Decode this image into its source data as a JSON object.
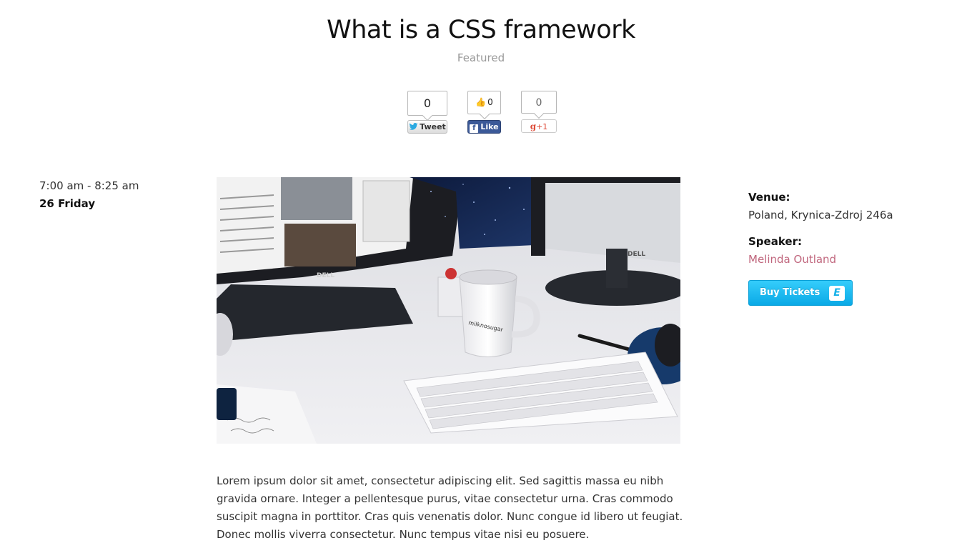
{
  "event": {
    "title": "What is a CSS framework",
    "category": "Featured",
    "time": "7:00 am - 8:25 am",
    "date": "26 Friday",
    "description": "Lorem ipsum dolor sit amet, consectetur adipiscing elit. Sed sagittis massa eu nibh gravida ornare. Integer a pellentesque purus, vitae consectetur urna. Cras commodo suscipit magna in porttitor. Cras quis venenatis dolor. Nunc congue id libero ut feugiat. Donec mollis viverra consectetur. Nunc tempus vitae nisi eu posuere."
  },
  "share": {
    "twitter": {
      "count": "0",
      "label": "Tweet",
      "icon": "twitter-bird-icon"
    },
    "facebook": {
      "count": "0",
      "label": "Like",
      "icon": "facebook-f-icon"
    },
    "google": {
      "count": "0",
      "label": "+1",
      "icon": "google-g-icon"
    }
  },
  "details": {
    "venue_label": "Venue:",
    "venue": "Poland, Krynica-Zdroj 246a",
    "speaker_label": "Speaker:",
    "speaker": "Melinda Outland",
    "buy_label": "Buy Tickets",
    "buy_icon_text": "E"
  },
  "hero_image": {
    "monitor_brand": "DELL",
    "mug_text": "milknosugar"
  },
  "colors": {
    "speaker_link": "#c0667d",
    "buy_button": "#1bbdf2",
    "facebook": "#3b5998",
    "google": "#dd4b39"
  }
}
